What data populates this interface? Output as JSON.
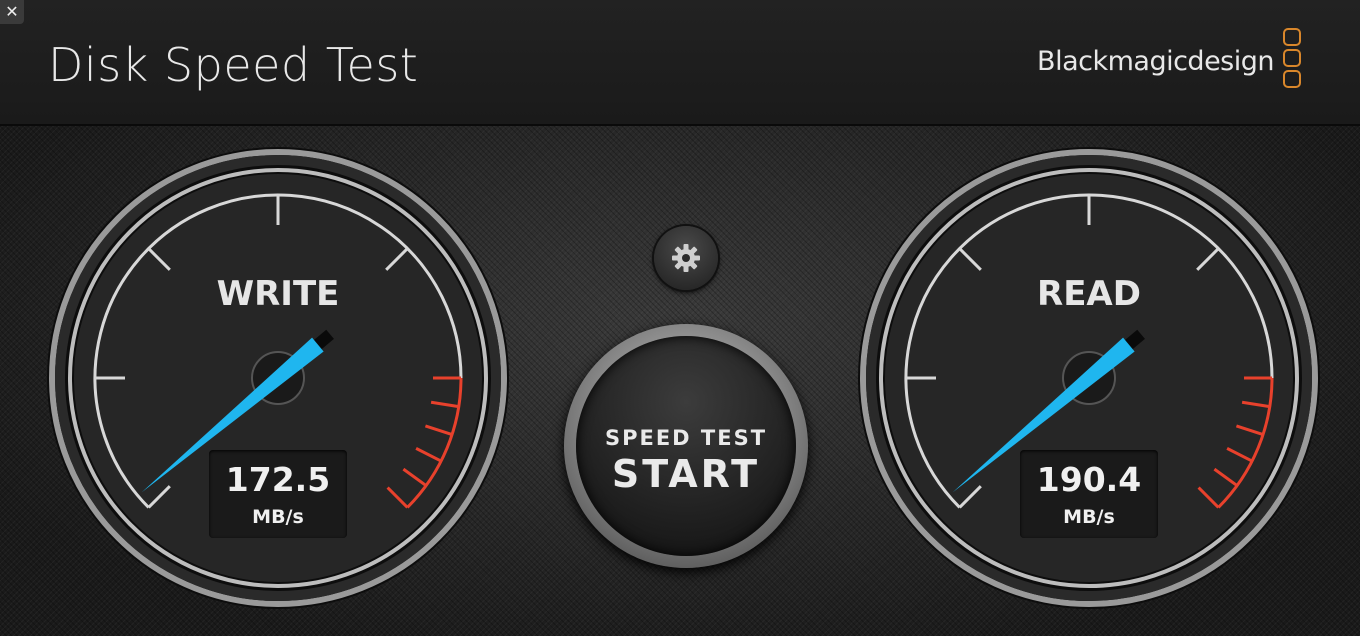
{
  "window": {
    "close_icon": "close-icon"
  },
  "header": {
    "title": "Disk Speed Test",
    "brand": "Blackmagicdesign",
    "logo": "blackmagic-logo-icon"
  },
  "colors": {
    "needle": "#1fb6ef",
    "redline": "#e8412c",
    "brand_orange": "#d9872b"
  },
  "gauges": {
    "write": {
      "label": "WRITE",
      "value": "172.5",
      "unit": "MB/s"
    },
    "read": {
      "label": "READ",
      "value": "190.4",
      "unit": "MB/s"
    }
  },
  "settings": {
    "icon": "gear-icon"
  },
  "start_button": {
    "top": "SPEED TEST",
    "main": "START"
  }
}
